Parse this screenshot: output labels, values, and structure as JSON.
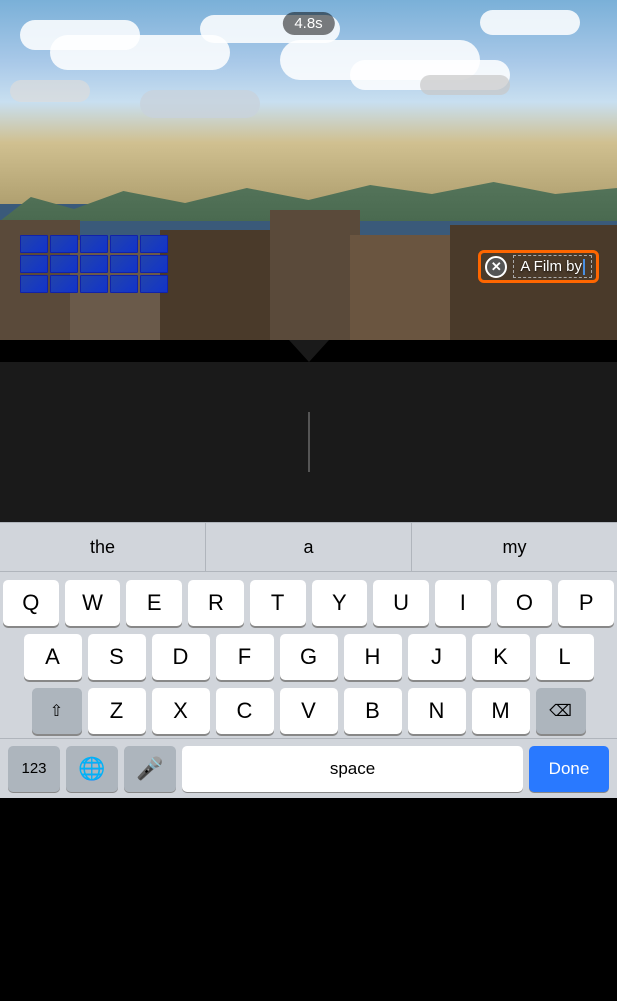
{
  "timer": {
    "label": "4.8s"
  },
  "text_overlay": {
    "content": "A Film by",
    "close_icon": "✕"
  },
  "autocomplete": {
    "suggestions": [
      "the",
      "a",
      "my"
    ]
  },
  "keyboard": {
    "rows": [
      [
        "Q",
        "W",
        "E",
        "R",
        "T",
        "Y",
        "U",
        "I",
        "O",
        "P"
      ],
      [
        "A",
        "S",
        "D",
        "F",
        "G",
        "H",
        "J",
        "K",
        "L"
      ],
      [
        "Z",
        "X",
        "C",
        "V",
        "B",
        "N",
        "M"
      ]
    ],
    "shift_label": "⇧",
    "delete_label": "⌫",
    "numbers_label": "123",
    "space_label": "space",
    "done_label": "Done",
    "globe_icon": "🌐",
    "mic_icon": "🎤"
  }
}
